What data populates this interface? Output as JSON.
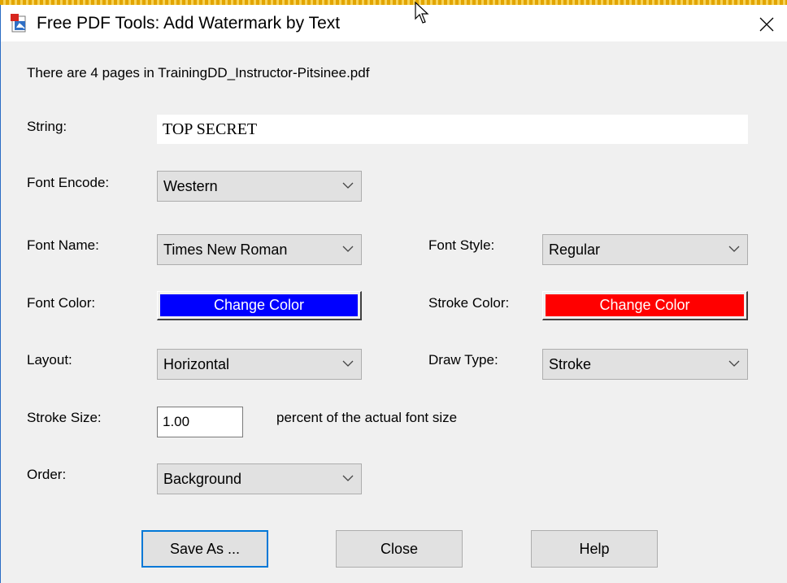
{
  "window": {
    "title": "Free PDF Tools: Add Watermark by Text",
    "close_glyph": "✕",
    "app_icon": "pdf-document-icon"
  },
  "info": {
    "pages_text": "There are 4 pages in TrainingDD_Instructor-Pitsinee.pdf"
  },
  "string": {
    "label": "String:",
    "value": "TOP SECRET"
  },
  "font_encode": {
    "label": "Font Encode:",
    "value": "Western"
  },
  "font_name": {
    "label": "Font Name:",
    "value": "Times New Roman"
  },
  "font_style": {
    "label": "Font Style:",
    "value": "Regular"
  },
  "font_color": {
    "label": "Font Color:",
    "button_label": "Change Color",
    "color": "#0000ff"
  },
  "stroke_color": {
    "label": "Stroke Color:",
    "button_label": "Change Color",
    "color": "#ff0000"
  },
  "layout": {
    "label": "Layout:",
    "value": "Horizontal"
  },
  "draw_type": {
    "label": "Draw Type:",
    "value": "Stroke"
  },
  "stroke_size": {
    "label": "Stroke Size:",
    "value": "1.00",
    "suffix": "percent of the actual font size"
  },
  "order": {
    "label": "Order:",
    "value": "Background"
  },
  "buttons": {
    "save_as": "Save As ...",
    "close": "Close",
    "help": "Help"
  }
}
